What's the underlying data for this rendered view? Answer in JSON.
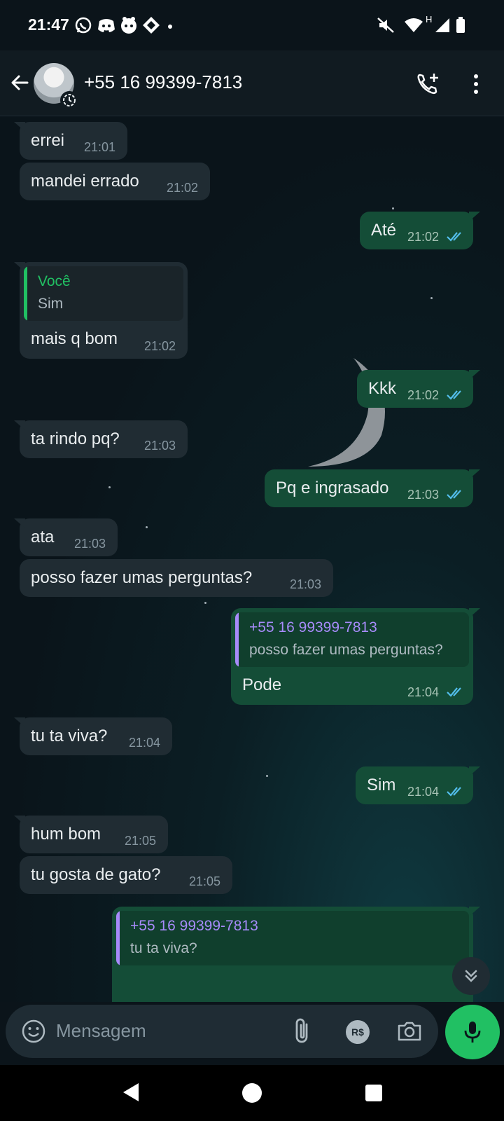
{
  "status_bar": {
    "time": "21:47",
    "left_icons": [
      "whatsapp-icon",
      "discord-icon",
      "face-app-icon",
      "diamond-app-icon",
      "dot-icon"
    ],
    "right_icons": [
      "mute-icon",
      "wifi-icon",
      "signal-icon",
      "battery-icon"
    ],
    "network_label": "H"
  },
  "header": {
    "contact_name": "+55 16 99399-7813",
    "icons": [
      "back-arrow-icon",
      "avatar",
      "status-clock-icon",
      "add-call-icon",
      "more-vert-icon"
    ]
  },
  "messages": [
    {
      "dir": "in",
      "text": "errei",
      "time": "21:01"
    },
    {
      "dir": "in",
      "text": "mandei errado",
      "time": "21:02"
    },
    {
      "dir": "out",
      "text": "Até",
      "time": "21:02",
      "read": true
    },
    {
      "dir": "in",
      "reply_author": "Você",
      "reply_text": "Sim",
      "text": "mais q bom",
      "time": "21:02"
    },
    {
      "dir": "out",
      "text": "Kkk",
      "time": "21:02",
      "read": true
    },
    {
      "dir": "in",
      "text": "ta rindo pq?",
      "time": "21:03"
    },
    {
      "dir": "out",
      "text": "Pq e ingrasado",
      "time": "21:03",
      "read": true
    },
    {
      "dir": "in",
      "text": "ata",
      "time": "21:03"
    },
    {
      "dir": "in",
      "text": "posso fazer umas perguntas?",
      "time": "21:03"
    },
    {
      "dir": "out",
      "reply_author": "+55 16 99399-7813",
      "reply_text": "posso fazer umas perguntas?",
      "text": "Pode",
      "time": "21:04",
      "read": true
    },
    {
      "dir": "in",
      "text": "tu ta viva?",
      "time": "21:04"
    },
    {
      "dir": "out",
      "text": "Sim",
      "time": "21:04",
      "read": true
    },
    {
      "dir": "in",
      "text": "hum bom",
      "time": "21:05"
    },
    {
      "dir": "in",
      "text": "tu gosta de gato?",
      "time": "21:05"
    },
    {
      "dir": "out",
      "reply_author": "+55 16 99399-7813",
      "reply_text": "tu ta viva?",
      "text": "",
      "time": "",
      "read": true
    }
  ],
  "input": {
    "placeholder": "Mensagem",
    "pay_label": "R$"
  },
  "colors": {
    "in_bubble": "#202c33",
    "out_bubble": "#144d37",
    "reply_self_author": "#21c063",
    "reply_contact_author": "#a78bfa",
    "read_ticks": "#53bdeb",
    "mic_button": "#21c063"
  }
}
